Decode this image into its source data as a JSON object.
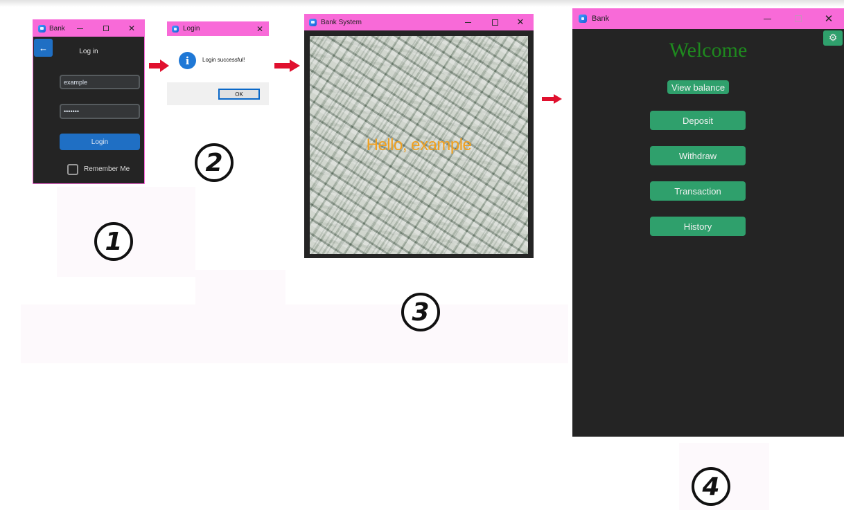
{
  "step1": {
    "title": "Bank",
    "heading": "Log in",
    "username_value": "example",
    "password_value": "•••••••",
    "login_label": "Login",
    "remember_label": "Remember Me",
    "step_number": "1"
  },
  "step2": {
    "title": "Login",
    "message": "Login successful!",
    "ok_label": "OK",
    "step_number": "2"
  },
  "step3": {
    "title": "Bank System",
    "greeting": "Hello, example",
    "step_number": "3"
  },
  "step4": {
    "title": "Bank",
    "welcome": "Welcome",
    "view_balance_label": "View balance",
    "deposit_label": "Deposit",
    "withdraw_label": "Withdraw",
    "transaction_label": "Transaction",
    "history_label": "History",
    "step_number": "4"
  },
  "colors": {
    "titlebar": "#f86ad8",
    "dark_bg": "#242424",
    "accent_green": "#2fa06c",
    "login_blue": "#1f6fc4",
    "greeting_orange": "#f0a020",
    "welcome_green": "#1e8a1e",
    "arrow_red": "#e0102e"
  },
  "icons": [
    "back-arrow-icon",
    "info-icon",
    "settings-gear-icon",
    "minimize-icon",
    "maximize-icon",
    "close-icon",
    "app-icon"
  ]
}
